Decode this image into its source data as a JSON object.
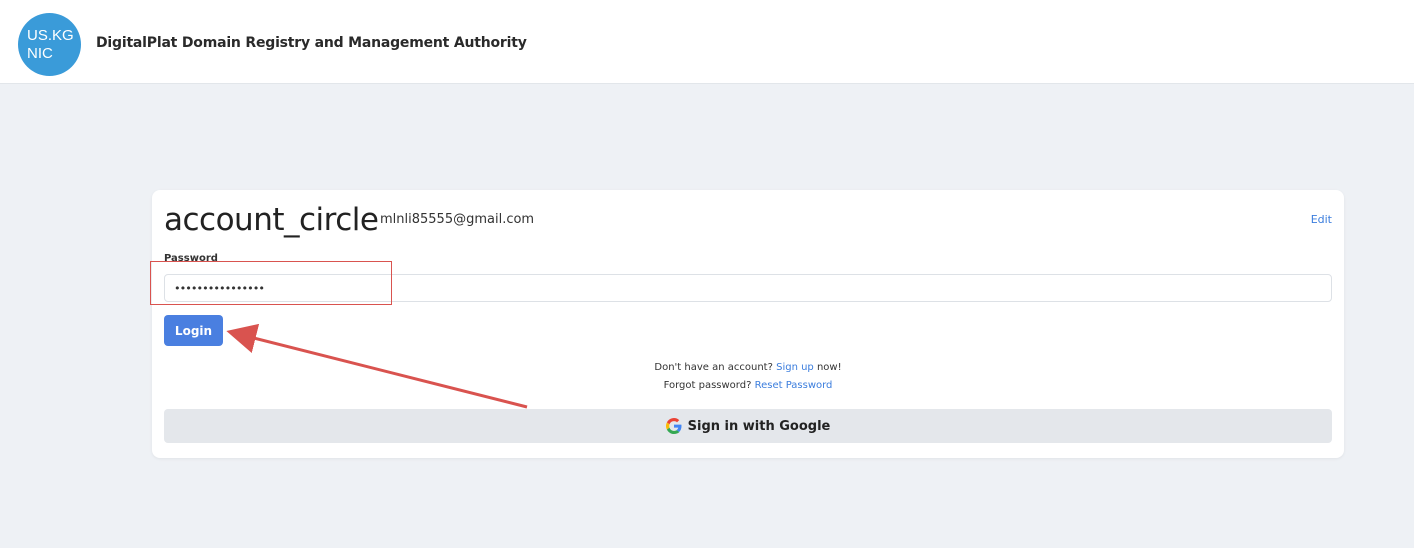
{
  "header": {
    "logo_line1": "US.KG",
    "logo_line2": "NIC",
    "title": "DigitalPlat Domain Registry and Management Authority"
  },
  "login_card": {
    "account_icon_text": "account_circle",
    "email": "mlnli85555@gmail.com",
    "edit_label": "Edit",
    "password_label": "Password",
    "password_value": "••••••••••••••••",
    "login_label": "Login",
    "signup_prefix": "Don't have an account? ",
    "signup_link": "Sign up",
    "signup_suffix": " now!",
    "forgot_prefix": "Forgot password? ",
    "reset_link": "Reset Password",
    "google_label": "Sign in with Google"
  },
  "colors": {
    "accent": "#4a7fe0",
    "link": "#3b7ddd",
    "annotation": "#d9534f",
    "logo_bg": "#3a9bd9"
  }
}
